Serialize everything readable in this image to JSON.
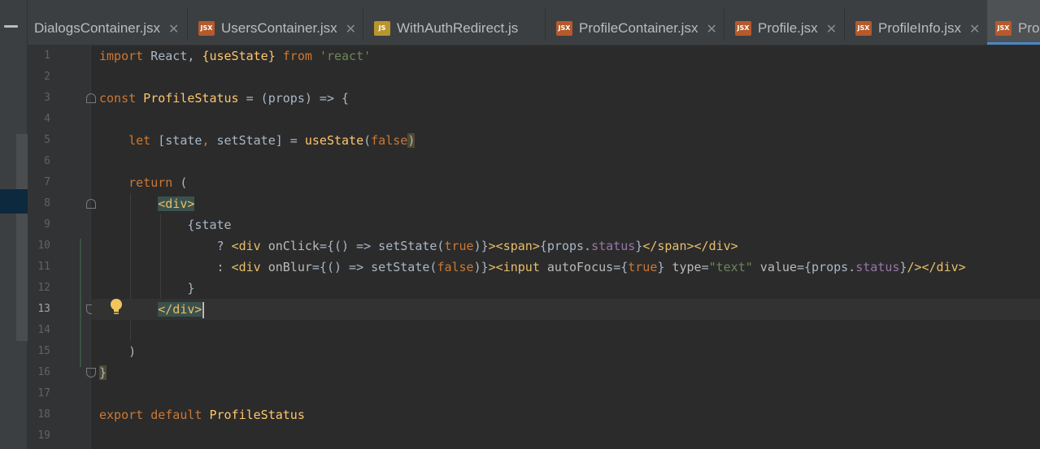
{
  "tabs": [
    {
      "label": "DialogsContainer.jsx",
      "icon": "none",
      "closable": true
    },
    {
      "label": "UsersContainer.jsx",
      "icon": "jsx",
      "closable": true
    },
    {
      "label": "WithAuthRedirect.js",
      "icon": "js",
      "closable": false
    },
    {
      "label": "ProfileContainer.jsx",
      "icon": "jsx",
      "closable": true
    },
    {
      "label": "Profile.jsx",
      "icon": "jsx",
      "closable": true
    },
    {
      "label": "ProfileInfo.jsx",
      "icon": "jsx",
      "closable": true
    },
    {
      "label": "Pro",
      "icon": "jsx",
      "closable": false,
      "active": true
    }
  ],
  "icon_text": {
    "jsx": "JSX",
    "js": "JS"
  },
  "close_glyph": "✕",
  "line_numbers": [
    "1",
    "2",
    "3",
    "4",
    "5",
    "6",
    "7",
    "8",
    "9",
    "10",
    "11",
    "12",
    "13",
    "14",
    "15",
    "16",
    "17",
    "18",
    "19"
  ],
  "current_line": 13,
  "colors": {
    "background": "#2b2b2b",
    "keyword": "#cc7832",
    "function": "#ffc66d",
    "string": "#6a8759",
    "tag": "#e8bf6a",
    "property": "#9876aa",
    "accent": "#4a88c7"
  },
  "code": {
    "l1": {
      "t1": "import",
      "t2": " React, ",
      "t3": "{useState}",
      "t4": " from ",
      "t5": "'react'"
    },
    "l3": {
      "t1": "const",
      "t2": " ProfileStatus",
      "t3": " = (props) => {"
    },
    "l5": {
      "t1": "let",
      "t2": " [state",
      "t3": ", ",
      "t4": "setState] = ",
      "t5": "useState",
      "t6": "(",
      "t7": "false",
      "t8": ")"
    },
    "l7": {
      "t1": "return",
      "t2": " ("
    },
    "l8": {
      "t1": "<div>"
    },
    "l9": {
      "t1": "{state"
    },
    "l10": {
      "t1": "? ",
      "t2": "<div ",
      "t3": "onClick",
      "t4": "={() => setState(",
      "t5": "true",
      "t6": ")}",
      "t7": "><span>",
      "t8": "{props.",
      "t9": "status",
      "t10": "}",
      "t11": "</span></div>"
    },
    "l11": {
      "t1": ": ",
      "t2": "<div ",
      "t3": "onBlur",
      "t4": "={() => setState(",
      "t5": "false",
      "t6": ")}",
      "t7": "><input ",
      "t8": "autoFocus",
      "t9": "={",
      "t10": "true",
      "t11": "} ",
      "t12": "type",
      "t13": "=",
      "t14": "\"text\"",
      "t15": " value",
      "t16": "={props.",
      "t17": "status",
      "t18": "}",
      "t19": "/></div>"
    },
    "l12": {
      "t1": "}"
    },
    "l13": {
      "t1": "</div>"
    },
    "l15": {
      "t1": ")"
    },
    "l16": {
      "t1": "}"
    },
    "l18": {
      "t1": "export",
      "t2": " default",
      "t3": " ProfileStatus"
    }
  }
}
